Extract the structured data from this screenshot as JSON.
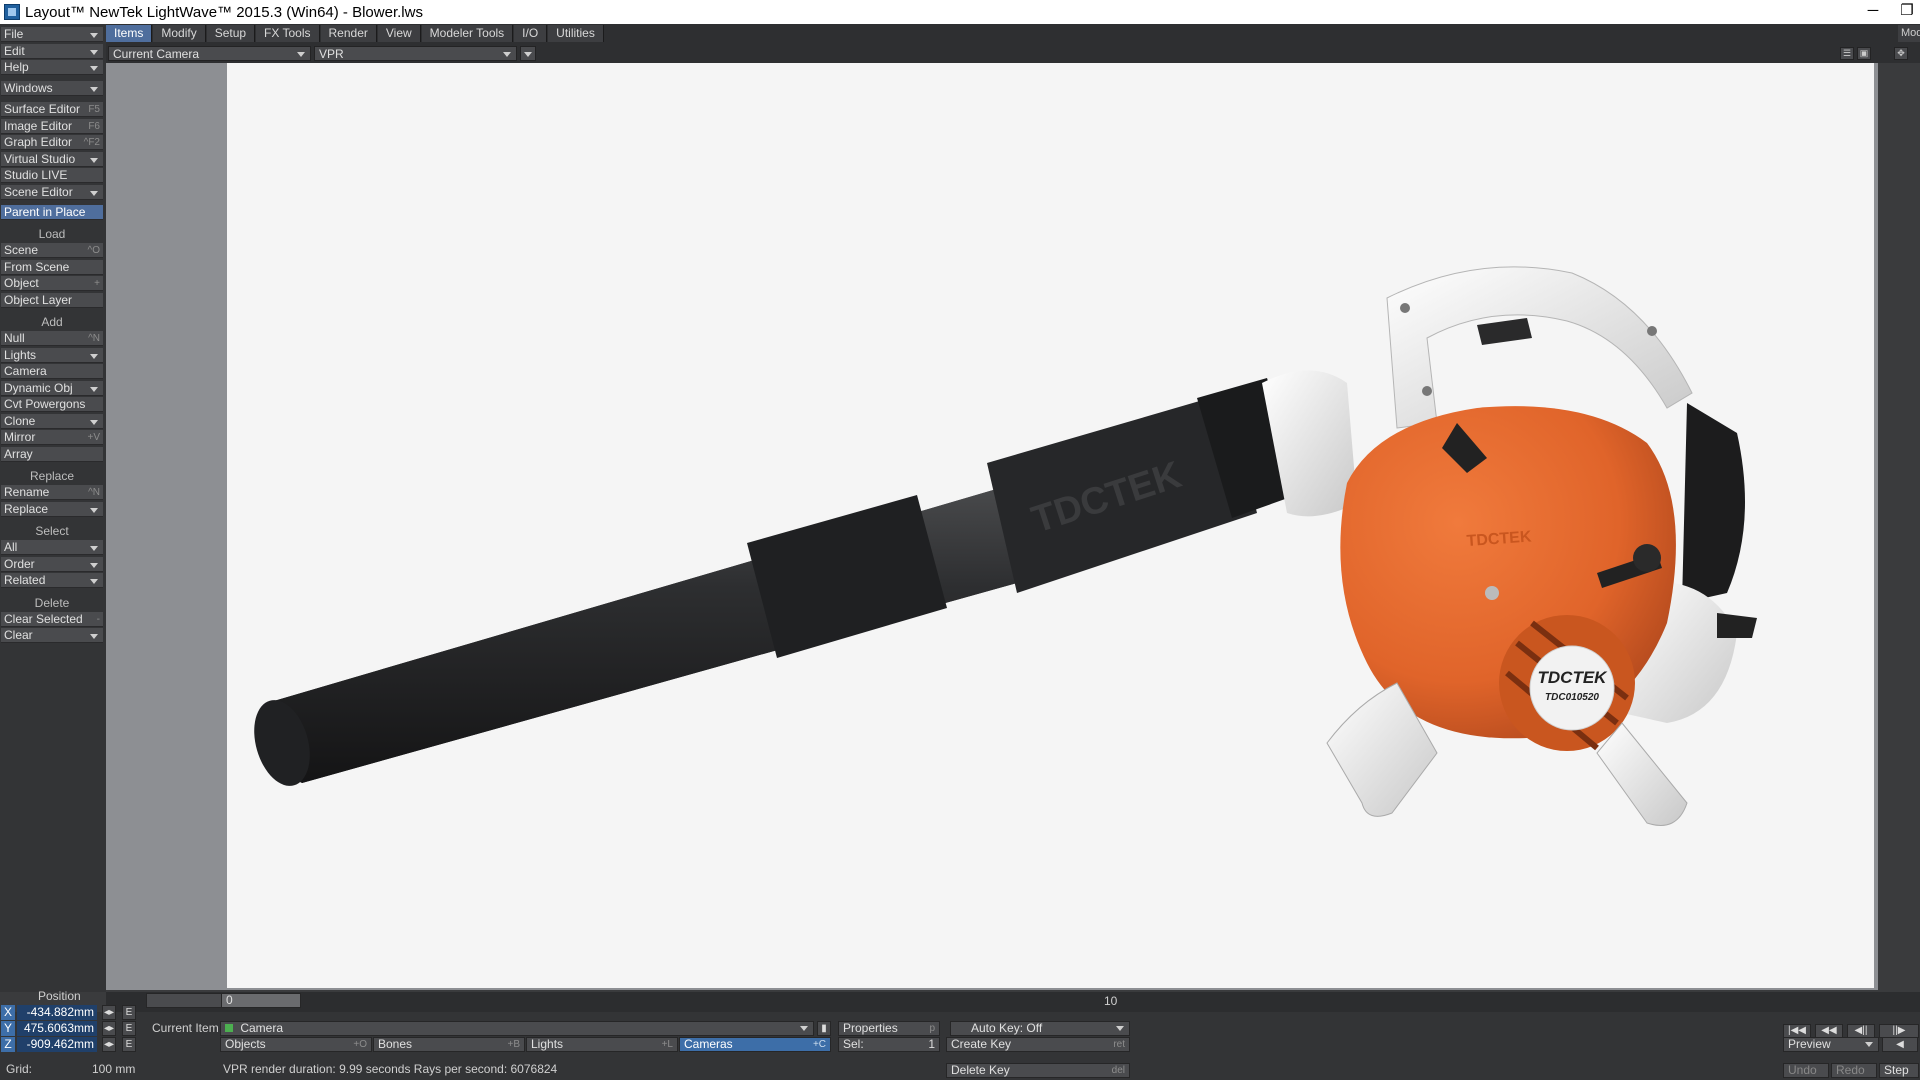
{
  "window": {
    "title": "Layout™ NewTek LightWave™ 2015.3 (Win64) - Blower.lws",
    "minimize_glyph": "─",
    "restore_glyph": "❐"
  },
  "menu_tabs": [
    "Items",
    "Modify",
    "Setup",
    "FX Tools",
    "Render",
    "View",
    "Modeler Tools",
    "I/O",
    "Utilities"
  ],
  "menu_right": "Mod",
  "left_panel": {
    "top_buttons": [
      {
        "label": "File",
        "dropdown": true
      },
      {
        "label": "Edit",
        "dropdown": true
      },
      {
        "label": "Help",
        "dropdown": true
      },
      {
        "label": "Windows",
        "dropdown": true
      }
    ],
    "tools": [
      {
        "label": "Surface Editor",
        "shortcut": "F5"
      },
      {
        "label": "Image Editor",
        "shortcut": "F6"
      },
      {
        "label": "Graph Editor",
        "shortcut": "^F2"
      },
      {
        "label": "Virtual Studio",
        "dropdown": true
      },
      {
        "label": "Studio LIVE"
      },
      {
        "label": "Scene Editor",
        "dropdown": true
      }
    ],
    "parent_in_place": "Parent in Place",
    "load_header": "Load",
    "load": [
      {
        "label": "Scene",
        "shortcut": "^O"
      },
      {
        "label": "From Scene"
      },
      {
        "label": "Object",
        "shortcut": "+"
      },
      {
        "label": "Object Layer"
      }
    ],
    "add_header": "Add",
    "add": [
      {
        "label": "Null",
        "shortcut": "^N"
      },
      {
        "label": "Lights",
        "dropdown": true
      },
      {
        "label": "Camera"
      },
      {
        "label": "Dynamic Obj",
        "dropdown": true
      },
      {
        "label": "Cvt Powergons"
      },
      {
        "label": "Clone",
        "dropdown": true
      },
      {
        "label": "Mirror",
        "shortcut": "+V"
      },
      {
        "label": "Array"
      }
    ],
    "replace_header": "Replace",
    "replace": [
      {
        "label": "Rename",
        "shortcut": "^N"
      },
      {
        "label": "Replace",
        "dropdown": true
      }
    ],
    "select_header": "Select",
    "select": [
      {
        "label": "All",
        "dropdown": true
      },
      {
        "label": "Order",
        "dropdown": true
      },
      {
        "label": "Related",
        "dropdown": true
      }
    ],
    "delete_header": "Delete",
    "delete": [
      {
        "label": "Clear Selected",
        "shortcut": "-"
      },
      {
        "label": "Clear",
        "dropdown": true
      }
    ]
  },
  "view_header": {
    "camera_select": "Current Camera",
    "render_mode": "VPR"
  },
  "viewport": {
    "brand": "TDCTEK",
    "model": "TDC010520",
    "tube_text": "TDCTEK",
    "housing_text": "TDCTEK",
    "colors": {
      "background": "#f5f5f5",
      "housing": "#e0642a",
      "tube": "#2b2c2e",
      "handle": "#e6e6e6"
    }
  },
  "timeline": {
    "start": "0",
    "current": "0",
    "tick_10": "10"
  },
  "bottom": {
    "position_label": "Position",
    "x": {
      "axis": "X",
      "value": "-434.882mm"
    },
    "y": {
      "axis": "Y",
      "value": "475.6063mm"
    },
    "z": {
      "axis": "Z",
      "value": "-909.462mm"
    },
    "e_label": "E",
    "frame_value": "0",
    "current_item_label": "Current Item",
    "current_item_value": "Camera",
    "properties": "Properties",
    "properties_sc": "p",
    "auto_key": "Auto Key: Off",
    "objects": "Objects",
    "objects_sc": "+O",
    "bones": "Bones",
    "bones_sc": "+B",
    "lights": "Lights",
    "lights_sc": "+L",
    "cameras": "Cameras",
    "cameras_sc": "+C",
    "sel_label": "Sel:",
    "sel_value": "1",
    "create_key": "Create Key",
    "create_key_sc": "ret",
    "delete_key": "Delete Key",
    "delete_key_sc": "del",
    "grid_label": "Grid:",
    "grid_value": "100 mm",
    "status": "VPR render duration: 9.99 seconds  Rays per second: 6076824",
    "preview": "Preview",
    "undo": "Undo",
    "redo": "Redo",
    "step": "Step"
  }
}
